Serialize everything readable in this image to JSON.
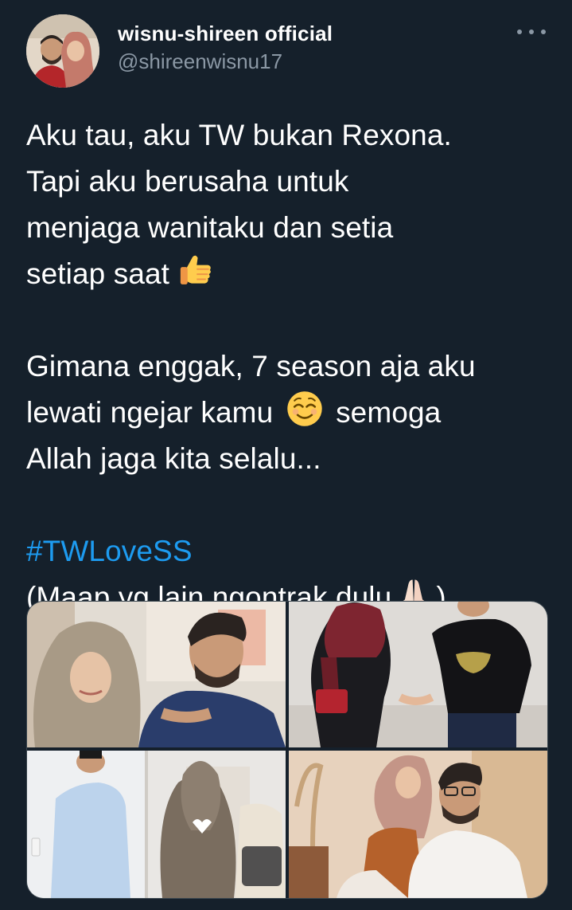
{
  "author": {
    "display_name": "wisnu-shireen official",
    "handle": "@shireenwisnu17",
    "avatar_icon": "profile-photo-couple"
  },
  "menu": {
    "icon": "more-options-icon"
  },
  "tweet": {
    "lines": [
      "Aku tau, aku TW bukan Rexona.",
      "Tapi aku berusaha untuk",
      "menjaga wanitaku dan setia",
      "setiap saat"
    ],
    "para2": [
      "Gimana enggak, 7 season aja aku",
      "lewati ngejar kamu",
      "semoga",
      "Allah jaga kita selalu..."
    ],
    "hashtag": "#TWLoveSS",
    "last_line": "(Maap yg lain ngontrak dulu",
    "last_close": ")",
    "emojis": [
      "thumbs-up-emoji",
      "relieved-face-emoji",
      "folded-hands-emoji"
    ]
  },
  "media": {
    "photos": [
      "couple-photo-1",
      "couple-photo-2",
      "couple-photo-3",
      "couple-photo-4"
    ]
  },
  "colors": {
    "background": "#15202b",
    "text": "#ffffff",
    "secondary": "#8b98a5",
    "link": "#1d9bf0"
  }
}
